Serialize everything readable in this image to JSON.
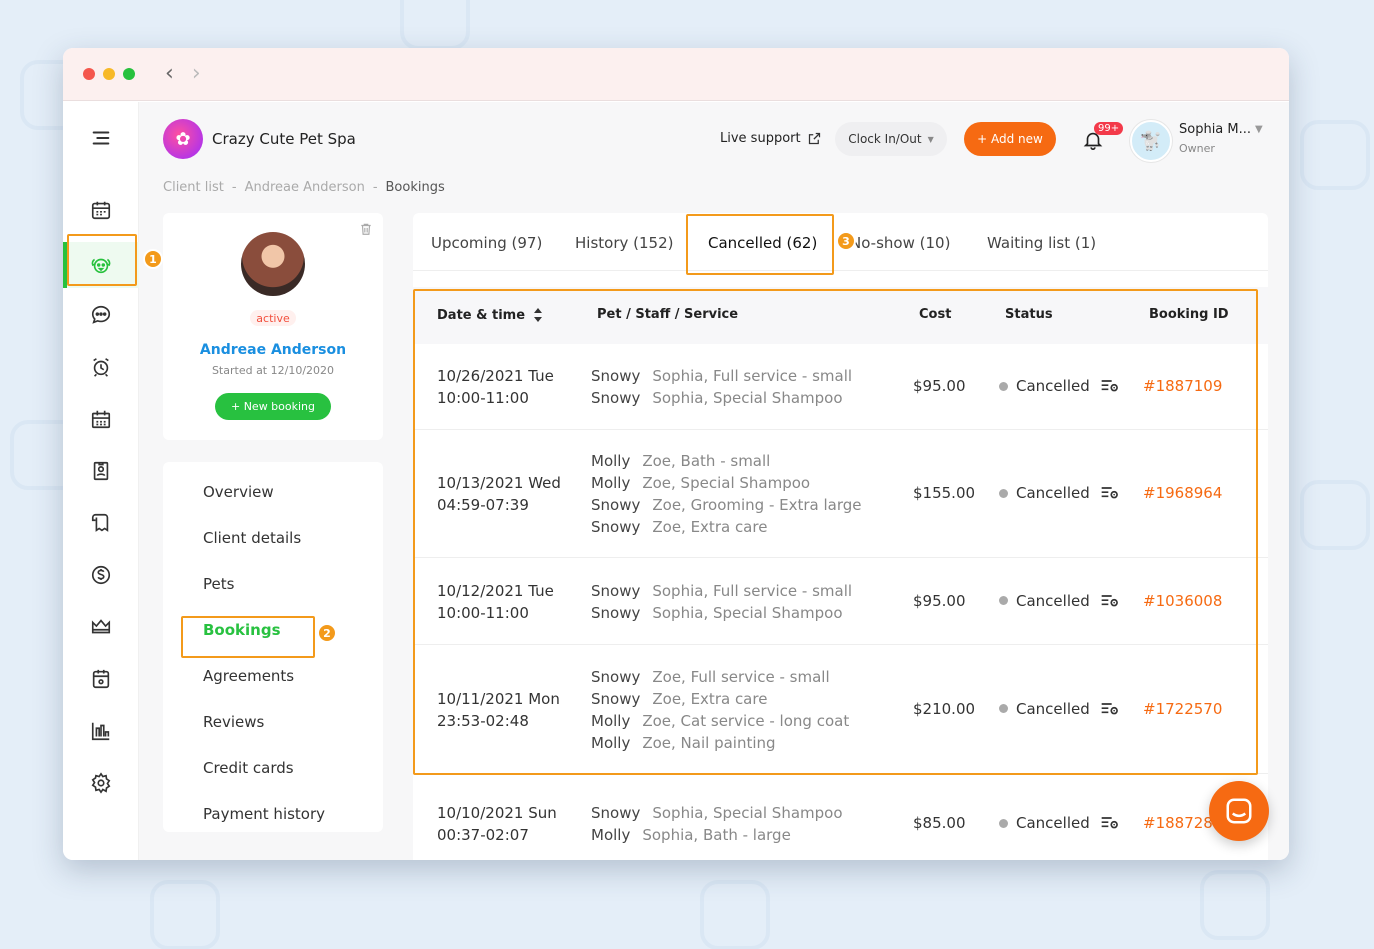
{
  "window": {
    "back": "‹",
    "forward": "›"
  },
  "brand": {
    "name": "Crazy Cute Pet Spa"
  },
  "topbar": {
    "live_support": "Live support",
    "clock": "Clock In/Out",
    "add_new": "+ Add new",
    "notifications_badge": "99+",
    "user_name": "Sophia M...",
    "user_role": "Owner"
  },
  "breadcrumb": {
    "items": [
      "Client list",
      "-",
      "Andreae Anderson",
      "-",
      "Bookings"
    ]
  },
  "profile": {
    "status": "active",
    "name": "Andreae Anderson",
    "started": "Started at 12/10/2020",
    "new_booking": "+ New booking"
  },
  "menu": {
    "items": [
      "Overview",
      "Client details",
      "Pets",
      "Bookings",
      "Agreements",
      "Reviews",
      "Credit cards",
      "Payment history"
    ]
  },
  "tabs": [
    "Upcoming (97)",
    "History (152)",
    "Cancelled (62)",
    "No-show (10)",
    "Waiting list (1)"
  ],
  "table": {
    "headers": [
      "Date & time",
      "Pet / Staff / Service",
      "Cost",
      "Status",
      "Booking ID"
    ],
    "rows": [
      {
        "date": "10/26/2021 Tue",
        "time": "10:00-11:00",
        "services": [
          [
            "Snowy",
            "Sophia, Full service - small"
          ],
          [
            "Snowy",
            "Sophia, Special Shampoo"
          ]
        ],
        "cost": "$95.00",
        "status": "Cancelled",
        "id": "#1887109"
      },
      {
        "date": "10/13/2021 Wed",
        "time": "04:59-07:39",
        "services": [
          [
            "Molly",
            "Zoe, Bath - small"
          ],
          [
            "Molly",
            "Zoe, Special Shampoo"
          ],
          [
            "Snowy",
            "Zoe, Grooming - Extra large"
          ],
          [
            "Snowy",
            "Zoe, Extra care"
          ]
        ],
        "cost": "$155.00",
        "status": "Cancelled",
        "id": "#1968964"
      },
      {
        "date": "10/12/2021 Tue",
        "time": "10:00-11:00",
        "services": [
          [
            "Snowy",
            "Sophia, Full service - small"
          ],
          [
            "Snowy",
            "Sophia, Special Shampoo"
          ]
        ],
        "cost": "$95.00",
        "status": "Cancelled",
        "id": "#1036008"
      },
      {
        "date": "10/11/2021 Mon",
        "time": "23:53-02:48",
        "services": [
          [
            "Snowy",
            "Zoe, Full service - small"
          ],
          [
            "Snowy",
            "Zoe, Extra care"
          ],
          [
            "Molly",
            "Zoe, Cat service - long coat"
          ],
          [
            "Molly",
            "Zoe, Nail painting"
          ]
        ],
        "cost": "$210.00",
        "status": "Cancelled",
        "id": "#1722570"
      },
      {
        "date": "10/10/2021 Sun",
        "time": "00:37-02:07",
        "services": [
          [
            "Snowy",
            "Sophia, Special Shampoo"
          ],
          [
            "Molly",
            "Sophia, Bath - large"
          ]
        ],
        "cost": "$85.00",
        "status": "Cancelled",
        "id": "#188728"
      }
    ]
  },
  "callouts": [
    "1",
    "2",
    "3"
  ],
  "icons": {
    "rail": [
      "menu-icon",
      "calendar-icon",
      "dog-icon",
      "chat-icon",
      "alarm-icon",
      "schedule-icon",
      "badge-icon",
      "receipt-icon",
      "dollar-icon",
      "crown-icon",
      "planner-icon",
      "chart-icon",
      "settings-icon"
    ]
  },
  "colors": {
    "accent_orange": "#f66a12",
    "accent_green": "#28c140",
    "highlight": "#f39a1b",
    "link_blue": "#1a8fe0"
  }
}
